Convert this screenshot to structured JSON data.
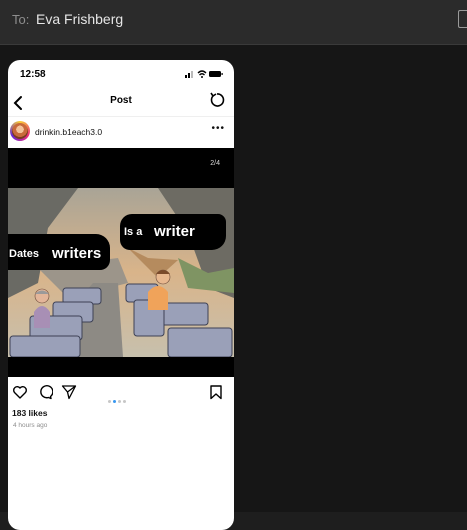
{
  "compose": {
    "to_label": "To:",
    "recipient": "Eva Frishberg"
  },
  "phone": {
    "status_time": "12:58",
    "nav_title": "Post"
  },
  "post": {
    "username": "drinkin.b1each3.0",
    "more": "•••",
    "media_counter": "2/4",
    "caption_left": {
      "small": "Dates",
      "big": "writers"
    },
    "caption_right": {
      "small": "Is a",
      "big": "writer"
    },
    "likes": "183 likes",
    "time_ago": "4 hours ago",
    "carousel": {
      "total": 4,
      "active": 2
    }
  },
  "icons": [
    "back-chevron-icon",
    "refresh-icon",
    "heart-icon",
    "comment-icon",
    "share-icon",
    "bookmark-icon"
  ],
  "colors": {
    "accent_dot": "#3897f0",
    "topbar": "#2b2b2b",
    "canvas": "#161616"
  }
}
